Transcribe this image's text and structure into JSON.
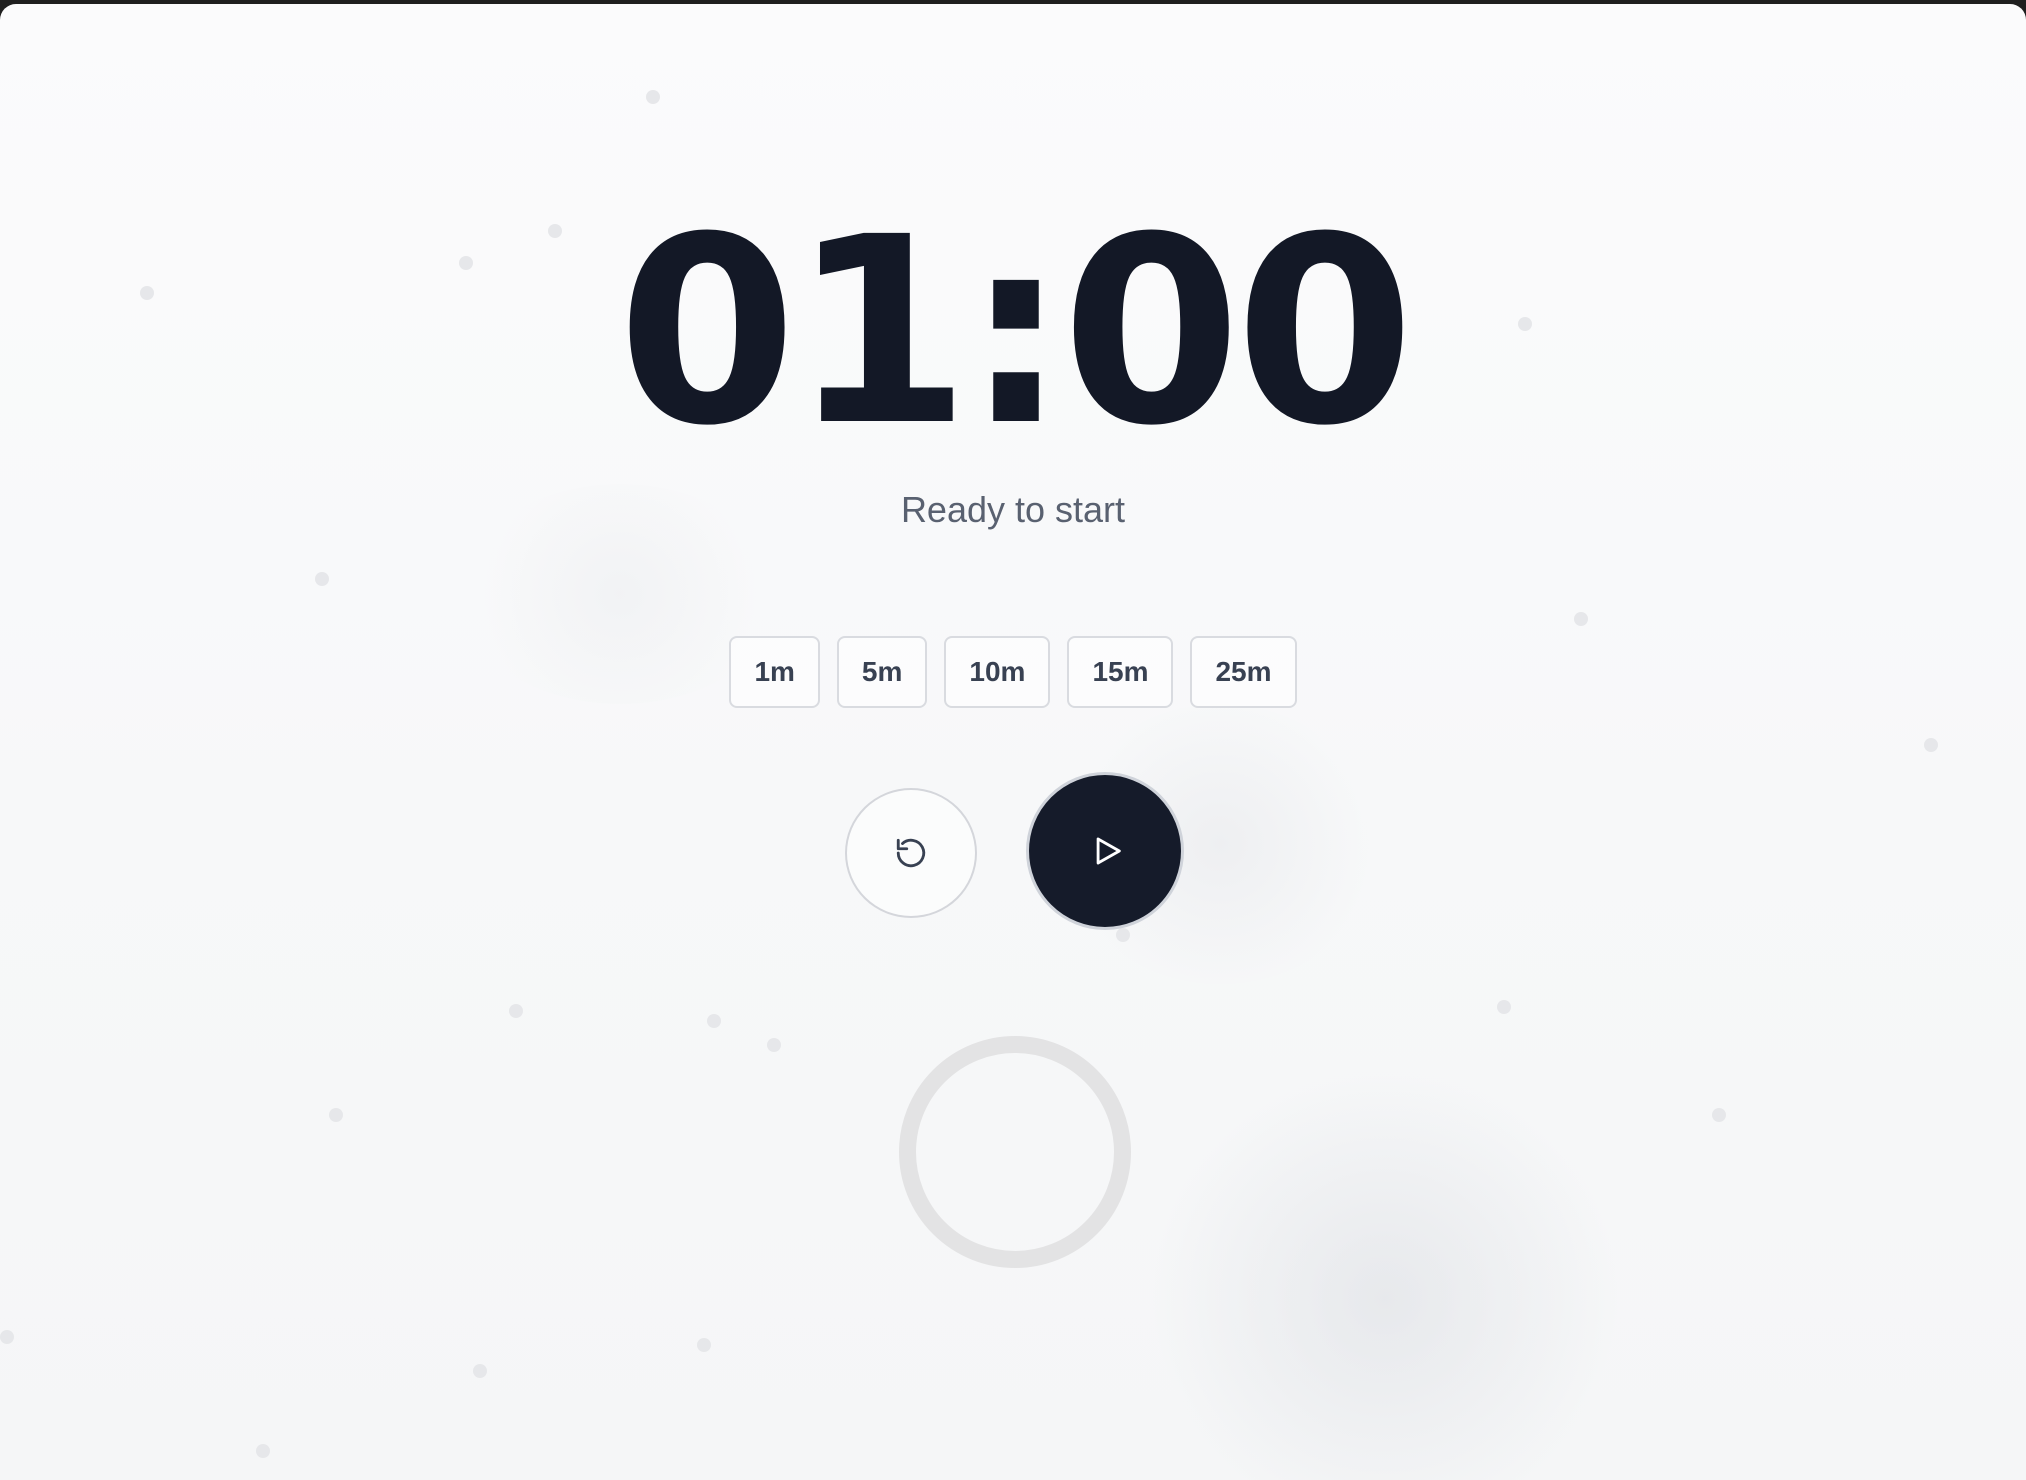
{
  "timer": {
    "display": "01:00",
    "status": "Ready to start"
  },
  "presets": [
    {
      "label": "1m"
    },
    {
      "label": "5m"
    },
    {
      "label": "10m"
    },
    {
      "label": "15m"
    },
    {
      "label": "25m"
    }
  ],
  "controls": {
    "reset_icon": "reset-icon",
    "play_icon": "play-icon"
  },
  "progress": {
    "fraction": 0
  },
  "colors": {
    "text_primary": "#131826",
    "text_muted": "#596170",
    "play_button": "#151b2a",
    "ring_track": "#e3e3e4"
  }
}
